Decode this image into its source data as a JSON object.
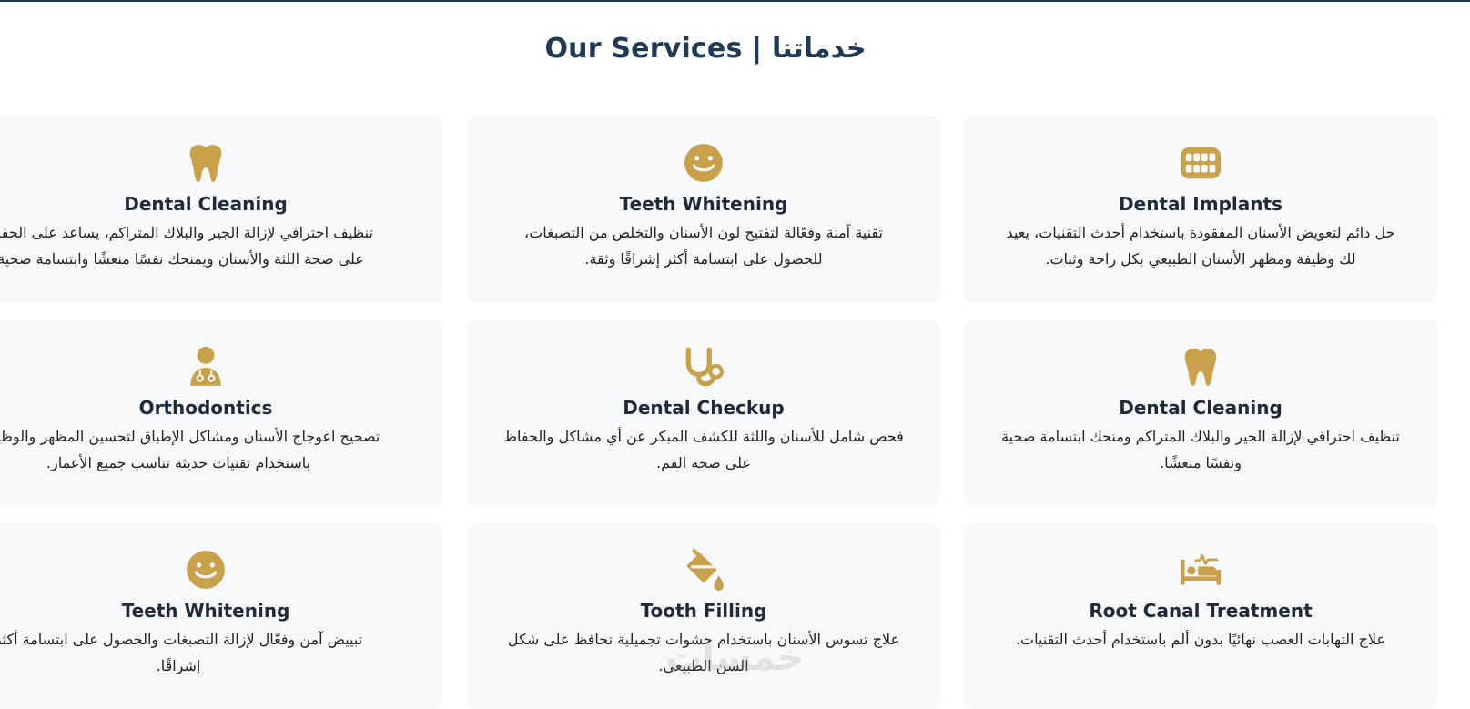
{
  "page": {
    "section_title": "Our Services | خدماتنا",
    "accent_color": "#c9a14a",
    "title_color": "#1e3a56",
    "watermark": "خمسات"
  },
  "services": [
    {
      "title": "Dental Cleaning",
      "description": "تنظيف احترافي لإزالة الجير والبلاك المتراكم، يساعد على الحفاظ على صحة اللثة والأسنان ويمنحك نفسًا منعشًا وابتسامة صحية.",
      "icon": "tooth-icon"
    },
    {
      "title": "Teeth Whitening",
      "description": "تقنية آمنة وفعّالة لتفتيح لون الأسنان والتخلص من التصبغات، للحصول على ابتسامة أكثر إشراقًا وثقة.",
      "icon": "smile-icon"
    },
    {
      "title": "Dental Implants",
      "description": "حل دائم لتعويض الأسنان المفقودة باستخدام أحدث التقنيات، يعيد لك وظيفة ومظهر الأسنان الطبيعي بكل راحة وثبات.",
      "icon": "teeth-implant-icon"
    },
    {
      "title": "Orthodontics",
      "description": "تصحيح اعوجاج الأسنان ومشاكل الإطباق لتحسين المظهر والوظيفة، باستخدام تقنيات حديثة تناسب جميع الأعمار.",
      "icon": "doctor-icon"
    },
    {
      "title": "Dental Checkup",
      "description": "فحص شامل للأسنان واللثة للكشف المبكر عن أي مشاكل والحفاظ على صحة الفم.",
      "icon": "stethoscope-icon"
    },
    {
      "title": "Dental Cleaning",
      "description": "تنظيف احترافي لإزالة الجير والبلاك المتراكم ومنحك ابتسامة صحية ونفسًا منعشًا.",
      "icon": "tooth-icon"
    },
    {
      "title": "Teeth Whitening",
      "description": "تبييض آمن وفعّال لإزالة التصبغات والحصول على ابتسامة أكثر إشراقًا.",
      "icon": "smile-icon"
    },
    {
      "title": "Tooth Filling",
      "description": "علاج تسوس الأسنان باستخدام حشوات تجميلية تحافظ على شكل السن الطبيعي.",
      "icon": "fill-drip-icon"
    },
    {
      "title": "Root Canal Treatment",
      "description": "علاج التهابات العصب نهائيًا بدون ألم باستخدام أحدث التقنيات.",
      "icon": "procedure-bed-icon"
    }
  ]
}
